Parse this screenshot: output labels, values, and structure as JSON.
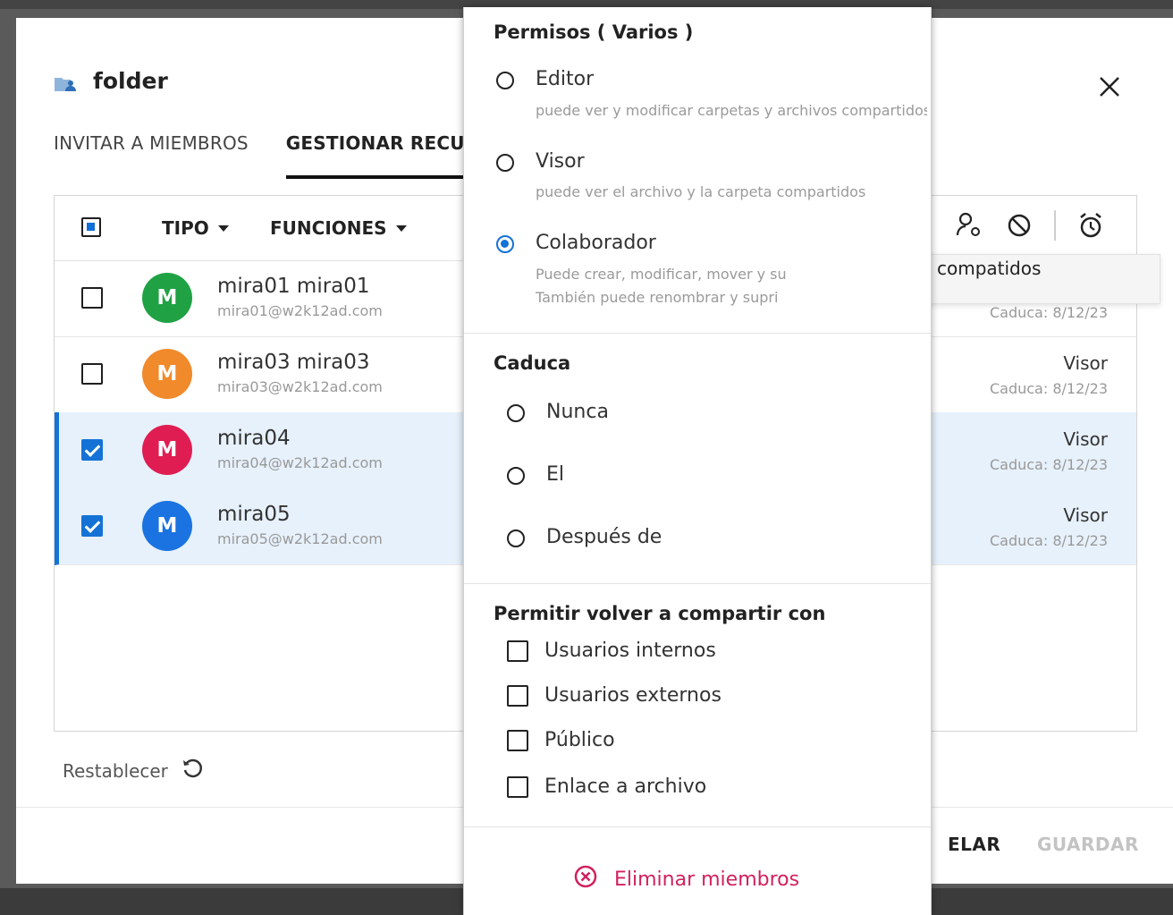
{
  "dialog": {
    "title": "folder",
    "tabs": [
      "INVITAR A MIEMBROS",
      "GESTIONAR RECURSOS"
    ],
    "table_headers": {
      "type": "TIPO",
      "functions": "FUNCIONES"
    },
    "members": [
      {
        "initial": "M",
        "name": "mira01 mira01",
        "email": "mira01@w2k12ad.com",
        "role": "",
        "expiry": "Caduca: 8/12/23",
        "color": "#20a244",
        "selected": false
      },
      {
        "initial": "M",
        "name": "mira03 mira03",
        "email": "mira03@w2k12ad.com",
        "role": "Visor",
        "expiry": "Caduca: 8/12/23",
        "color": "#f08a2b",
        "selected": false
      },
      {
        "initial": "M",
        "name": "mira04",
        "email": "mira04@w2k12ad.com",
        "role": "Visor",
        "expiry": "Caduca: 8/12/23",
        "color": "#e01d52",
        "selected": true
      },
      {
        "initial": "M",
        "name": "mira05",
        "email": "mira05@w2k12ad.com",
        "role": "Visor",
        "expiry": "Caduca: 8/12/23",
        "color": "#1a73e0",
        "selected": true
      }
    ],
    "tooltip": "Editar recursos compatidos seleccionados",
    "reset_label": "Restablecer",
    "cancel_label": "ELAR",
    "save_label": "GUARDAR",
    "toolbar_icons": [
      "user-settings-icon",
      "block-icon",
      "alarm-icon"
    ]
  },
  "panel": {
    "permissions_title": "Permisos ( Varios )",
    "permissions": [
      {
        "label": "Editor",
        "desc": [
          "puede ver y modificar carpetas y archivos compartidos"
        ],
        "selected": false
      },
      {
        "label": "Visor",
        "desc": [
          "puede ver el archivo y la carpeta compartidos"
        ],
        "selected": false
      },
      {
        "label": "Colaborador",
        "desc": [
          "Puede crear, modificar, mover y su",
          "También puede renombrar y supri"
        ],
        "selected": true
      }
    ],
    "expires_title": "Caduca",
    "expires_options": [
      {
        "label": "Nunca"
      },
      {
        "label": "El"
      },
      {
        "label": "Después de"
      }
    ],
    "reshare_title": "Permitir volver a compartir con",
    "reshare_options": [
      "Usuarios internos",
      "Usuarios externos",
      "Público",
      "Enlace a archivo"
    ],
    "remove_label": "Eliminar miembros"
  },
  "colors": {
    "accent": "#1472d6",
    "danger": "#d2215a"
  }
}
